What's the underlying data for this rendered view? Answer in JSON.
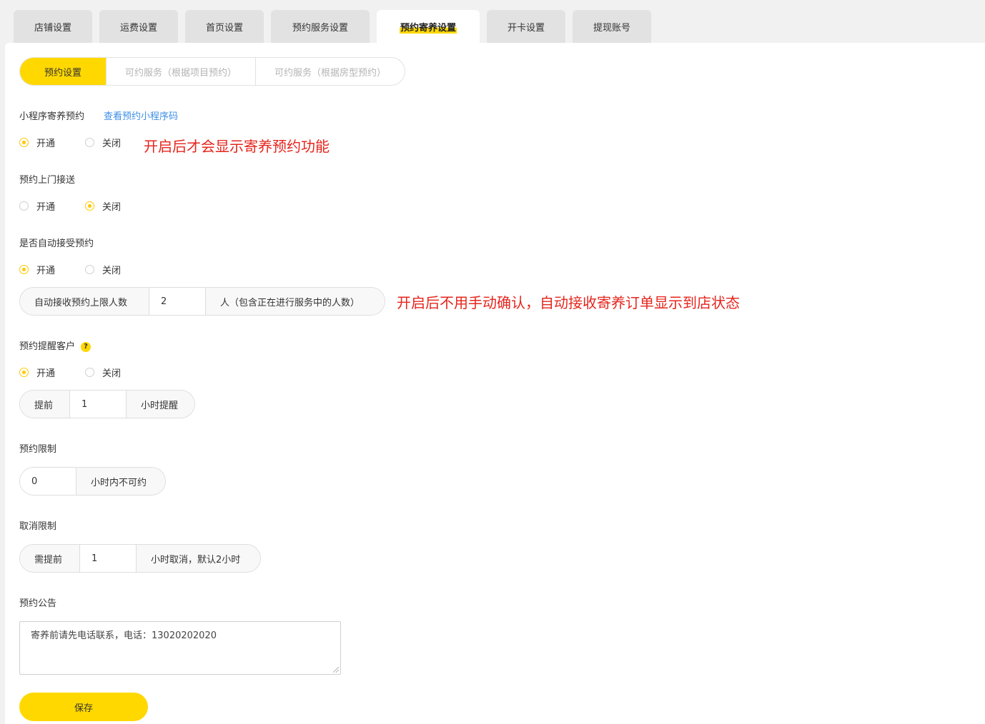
{
  "tabs": [
    {
      "label": "店铺设置",
      "active": false
    },
    {
      "label": "运费设置",
      "active": false
    },
    {
      "label": "首页设置",
      "active": false
    },
    {
      "label": "预约服务设置",
      "active": false
    },
    {
      "label": "预约寄养设置",
      "active": true
    },
    {
      "label": "开卡设置",
      "active": false
    },
    {
      "label": "提现账号",
      "active": false
    }
  ],
  "subtabs": [
    {
      "label": "预约设置",
      "active": true
    },
    {
      "label": "可约服务（根据项目预约）",
      "active": false
    },
    {
      "label": "可约服务（根据房型预约）",
      "active": false
    }
  ],
  "options": {
    "on": "开通",
    "off": "关闭"
  },
  "mini_program": {
    "label": "小程序寄养预约",
    "link": "查看预约小程序码",
    "selected": "开通",
    "note": "开启后才会显示寄养预约功能"
  },
  "door_pickup": {
    "label": "预约上门接送",
    "selected": "关闭"
  },
  "auto_accept": {
    "label": "是否自动接受预约",
    "selected": "开通",
    "prefix": "自动接收预约上限人数",
    "value": "2",
    "suffix": "人（包含正在进行服务中的人数）",
    "note": "开启后不用手动确认，自动接收寄养订单显示到店状态"
  },
  "reminder": {
    "label": "预约提醒客户",
    "help": "?",
    "selected": "开通",
    "prefix": "提前",
    "value": "1",
    "suffix": "小时提醒"
  },
  "booking_limit": {
    "label": "预约限制",
    "value": "0",
    "suffix": "小时内不可约"
  },
  "cancel_limit": {
    "label": "取消限制",
    "prefix": "需提前",
    "value": "1",
    "suffix": "小时取消，默认2小时"
  },
  "announcement": {
    "label": "预约公告",
    "value": "寄养前请先电话联系，电话：13020202020"
  },
  "save_label": "保存",
  "colors": {
    "accent": "#ffd800",
    "note": "#e5251c",
    "link": "#3b8ee5"
  }
}
